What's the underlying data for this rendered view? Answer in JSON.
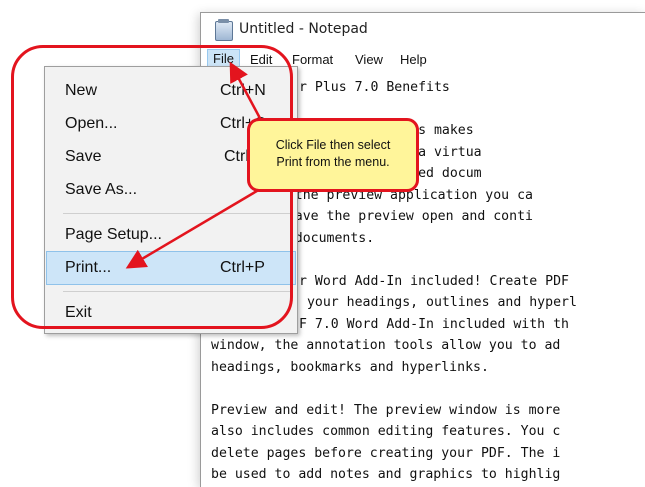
{
  "window": {
    "title": "Untitled - Notepad",
    "icon": "notepad-icon"
  },
  "menubar": {
    "items": [
      "File",
      "Edit",
      "Format",
      "View",
      "Help"
    ]
  },
  "document": {
    "lines": [
      "r Plus 7.0 Benefits",
      "",
      "PDF Creator Plus makes",
      " Plus combines a virtua",
      "lays your printed docum",
      "rom the preview application you ca",
      "r leave the preview open and conti",
      "ple documents.",
      "",
      "r Word Add-In included! Create PDF",
      " your headings, outlines and hyperl",
      "F 7.0 Word Add-In included with th",
      "window, the annotation tools allow you to ad",
      "headings, bookmarks and hyperlinks.",
      "",
      "Preview and edit! The preview window is more",
      "also includes common editing features. You c",
      "delete pages before creating your PDF. The i",
      "be used to add notes and graphics to highlig"
    ]
  },
  "file_menu": {
    "new_label": "New",
    "new_shortcut": "Ctrl+N",
    "open_label": "Open...",
    "open_shortcut": "Ctrl+O",
    "save_label": "Save",
    "save_shortcut": "Ctrl+S",
    "saveas_label": "Save As...",
    "pagesetup_label": "Page Setup...",
    "print_label": "Print...",
    "print_shortcut": "Ctrl+P",
    "exit_label": "Exit"
  },
  "callout": {
    "line1": "Click File then select",
    "line2": "Print from the menu."
  },
  "colors": {
    "highlight_red": "#e3141e",
    "callout_yellow": "#fff59a",
    "menu_selection": "#cde5f8"
  }
}
